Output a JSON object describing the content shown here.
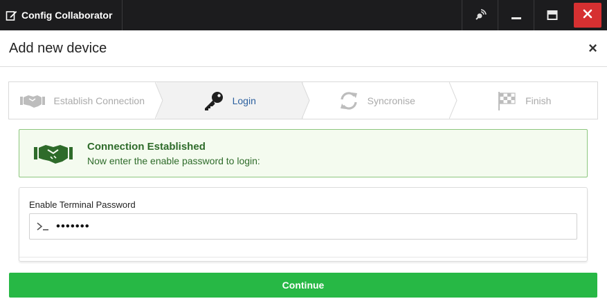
{
  "window": {
    "title": "Config Collaborator",
    "controls": [
      "satellite-icon",
      "minimize-icon",
      "maximize-icon",
      "close-icon"
    ]
  },
  "modal": {
    "title": "Add new device",
    "close_label": "×"
  },
  "steps": [
    {
      "label": "Establish Connection",
      "icon": "handshake-icon",
      "state": "done"
    },
    {
      "label": "Login",
      "icon": "key-icon",
      "state": "active"
    },
    {
      "label": "Syncronise",
      "icon": "sync-icon",
      "state": "pending"
    },
    {
      "label": "Finish",
      "icon": "checkered-flag-icon",
      "state": "pending"
    }
  ],
  "alert": {
    "title": "Connection Established",
    "message": "Now enter the enable password to login:",
    "icon": "handshake-icon"
  },
  "password": {
    "label": "Enable Terminal Password",
    "value": "•••••••",
    "prompt_icon": "terminal-icon"
  },
  "actions": {
    "continue_label": "Continue"
  },
  "colors": {
    "titlebar": "#1c1c1e",
    "close_button": "#d63031",
    "active_step_text": "#2a5f9e",
    "alert_bg": "#f4fbef",
    "alert_border": "#8cc67d",
    "alert_text": "#2e6b2a",
    "continue_button": "#27b845"
  }
}
